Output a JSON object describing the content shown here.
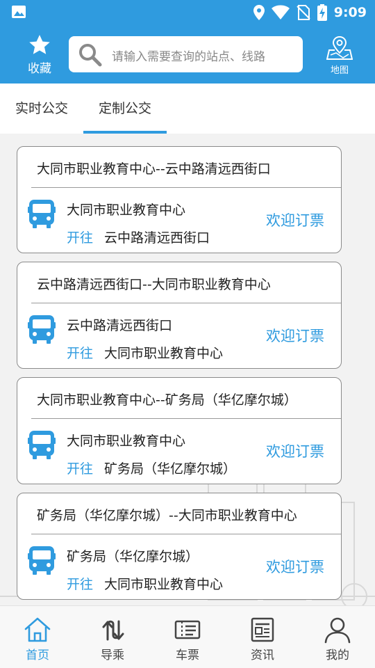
{
  "status_bar": {
    "time": "9:09"
  },
  "header": {
    "favorite_label": "收藏",
    "search_placeholder": "请输入需要查询的站点、线路",
    "map_label": "地图"
  },
  "tabs": [
    {
      "label": "实时公交",
      "active": false
    },
    {
      "label": "定制公交",
      "active": true
    }
  ],
  "routes": [
    {
      "title": "大同市职业教育中心--云中路清远西街口",
      "from": "大同市职业教育中心",
      "goto_label": "开往",
      "to": "云中路清远西街口",
      "action": "欢迎订票"
    },
    {
      "title": "云中路清远西街口--大同市职业教育中心",
      "from": "云中路清远西街口",
      "goto_label": "开往",
      "to": "大同市职业教育中心",
      "action": "欢迎订票"
    },
    {
      "title": "大同市职业教育中心--矿务局（华亿摩尔城）",
      "from": "大同市职业教育中心",
      "goto_label": "开往",
      "to": "矿务局（华亿摩尔城）",
      "action": "欢迎订票"
    },
    {
      "title": "矿务局（华亿摩尔城）--大同市职业教育中心",
      "from": "矿务局（华亿摩尔城）",
      "goto_label": "开往",
      "to": "大同市职业教育中心",
      "action": "欢迎订票"
    }
  ],
  "bottom_nav": [
    {
      "label": "首页",
      "icon": "home-icon",
      "active": true
    },
    {
      "label": "导乘",
      "icon": "transfer-icon",
      "active": false
    },
    {
      "label": "车票",
      "icon": "ticket-icon",
      "active": false
    },
    {
      "label": "资讯",
      "icon": "news-icon",
      "active": false
    },
    {
      "label": "我的",
      "icon": "profile-icon",
      "active": false
    }
  ],
  "colors": {
    "primary": "#2f9bdf",
    "text": "#222222",
    "background": "#f2f2f2"
  }
}
